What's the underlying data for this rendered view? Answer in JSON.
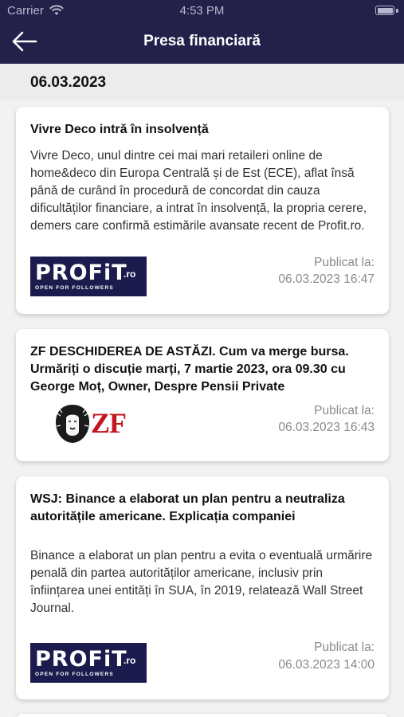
{
  "status_bar": {
    "carrier": "Carrier",
    "time": "4:53 PM"
  },
  "header": {
    "title": "Presa financiară"
  },
  "date_section": {
    "date": "06.03.2023"
  },
  "articles": [
    {
      "title": "Vivre Deco intră în insolvență",
      "body": "Vivre Deco, unul dintre cei mai mari retaileri online de home&deco din Europa Centrală și de Est (ECE), aflat însă până de curând în procedură de concordat din cauza dificultăților financiare, a intrat în insolvență, la propria cerere, demers care confirmă estimările avansate recent de Profit.ro.",
      "source_logo": "profit-logo",
      "logo_text": "PROFiT",
      "logo_suffix": ".ro",
      "logo_tagline": "OPEN FOR FOLLOWERS",
      "published_label": "Publicat la:",
      "published_at": "06.03.2023 16:47"
    },
    {
      "title": "ZF DESCHIDEREA DE ASTĂZI. Cum va merge bursa. Urmăriți o discuție marți, 7 martie 2023, ora 09.30 cu George Moț, Owner, Despre Pensii Private",
      "body": "",
      "source_logo": "zf-logo",
      "logo_text": "ZF",
      "published_label": "Publicat la:",
      "published_at": "06.03.2023 16:43"
    },
    {
      "title": "WSJ: Binance a  elaborat un plan pentru a neutraliza autoritățile americane. Explicația companiei",
      "body": "Binance a elaborat un plan pentru a evita o eventuală urmărire penală din partea autorităților americane, inclusiv prin înființarea unei entități în SUA, în 2019, relatează Wall Street Journal.",
      "source_logo": "profit-logo",
      "logo_text": "PROFiT",
      "logo_suffix": ".ro",
      "logo_tagline": "OPEN FOR FOLLOWERS",
      "published_label": "Publicat la:",
      "published_at": "06.03.2023 14:00"
    }
  ],
  "colors": {
    "header_bg": "#23204a",
    "profit_logo_bg": "#1c1b4d",
    "zf_red": "#c5161d"
  }
}
